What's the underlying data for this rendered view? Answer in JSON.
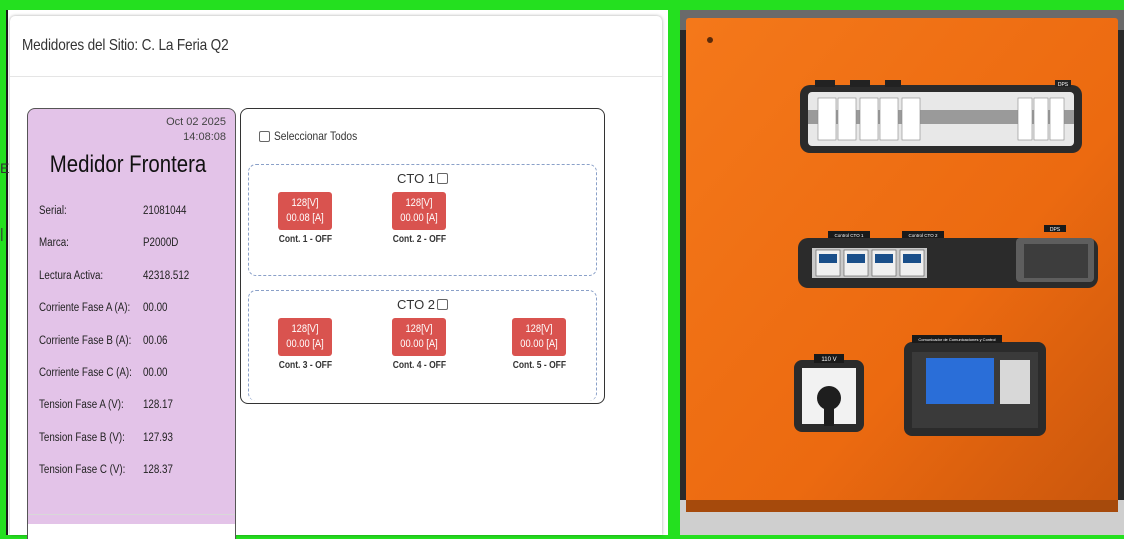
{
  "modal": {
    "title": "Medidores del Sitio: C. La Feria Q2"
  },
  "meter": {
    "date": "Oct 02 2025",
    "time": "14:08:08",
    "title": "Medidor Frontera",
    "rows": [
      {
        "label": "Serial:",
        "value": "21081044"
      },
      {
        "label": "Marca:",
        "value": "P2000D"
      },
      {
        "label": "Lectura Activa:",
        "value": "42318.512"
      },
      {
        "label": "Corriente Fase A (A):",
        "value": "00.00"
      },
      {
        "label": "Corriente Fase B (A):",
        "value": "00.06"
      },
      {
        "label": "Corriente Fase C (A):",
        "value": "00.00"
      },
      {
        "label": "Tension Fase A (V):",
        "value": "128.17"
      },
      {
        "label": "Tension Fase B (V):",
        "value": "127.93"
      },
      {
        "label": "Tension Fase C (V):",
        "value": "128.37"
      }
    ]
  },
  "controls": {
    "select_all": "Seleccionar Todos",
    "cto1": {
      "title": "CTO 1",
      "contactors": [
        {
          "voltage": "128[V]",
          "current": "00.08 [A]",
          "label": "Cont. 1 - OFF"
        },
        {
          "voltage": "128[V]",
          "current": "00.00 [A]",
          "label": "Cont. 2 - OFF"
        }
      ]
    },
    "cto2": {
      "title": "CTO 2",
      "contactors": [
        {
          "voltage": "128[V]",
          "current": "00.00 [A]",
          "label": "Cont. 3 - OFF"
        },
        {
          "voltage": "128[V]",
          "current": "00.00 [A]",
          "label": "Cont. 4 - OFF"
        },
        {
          "voltage": "128[V]",
          "current": "00.00 [A]",
          "label": "Cont. 5 - OFF"
        }
      ]
    },
    "off_color": "#d9534f"
  },
  "photo": {
    "labels": {
      "dps_top": "DPS",
      "control_cto1": "Control CTO 1",
      "control_cto2": "Control CTO 2",
      "dps_mid": "DPS",
      "outlet": "110 V",
      "box": "Comunicador de Comunicaciones y Control"
    }
  }
}
